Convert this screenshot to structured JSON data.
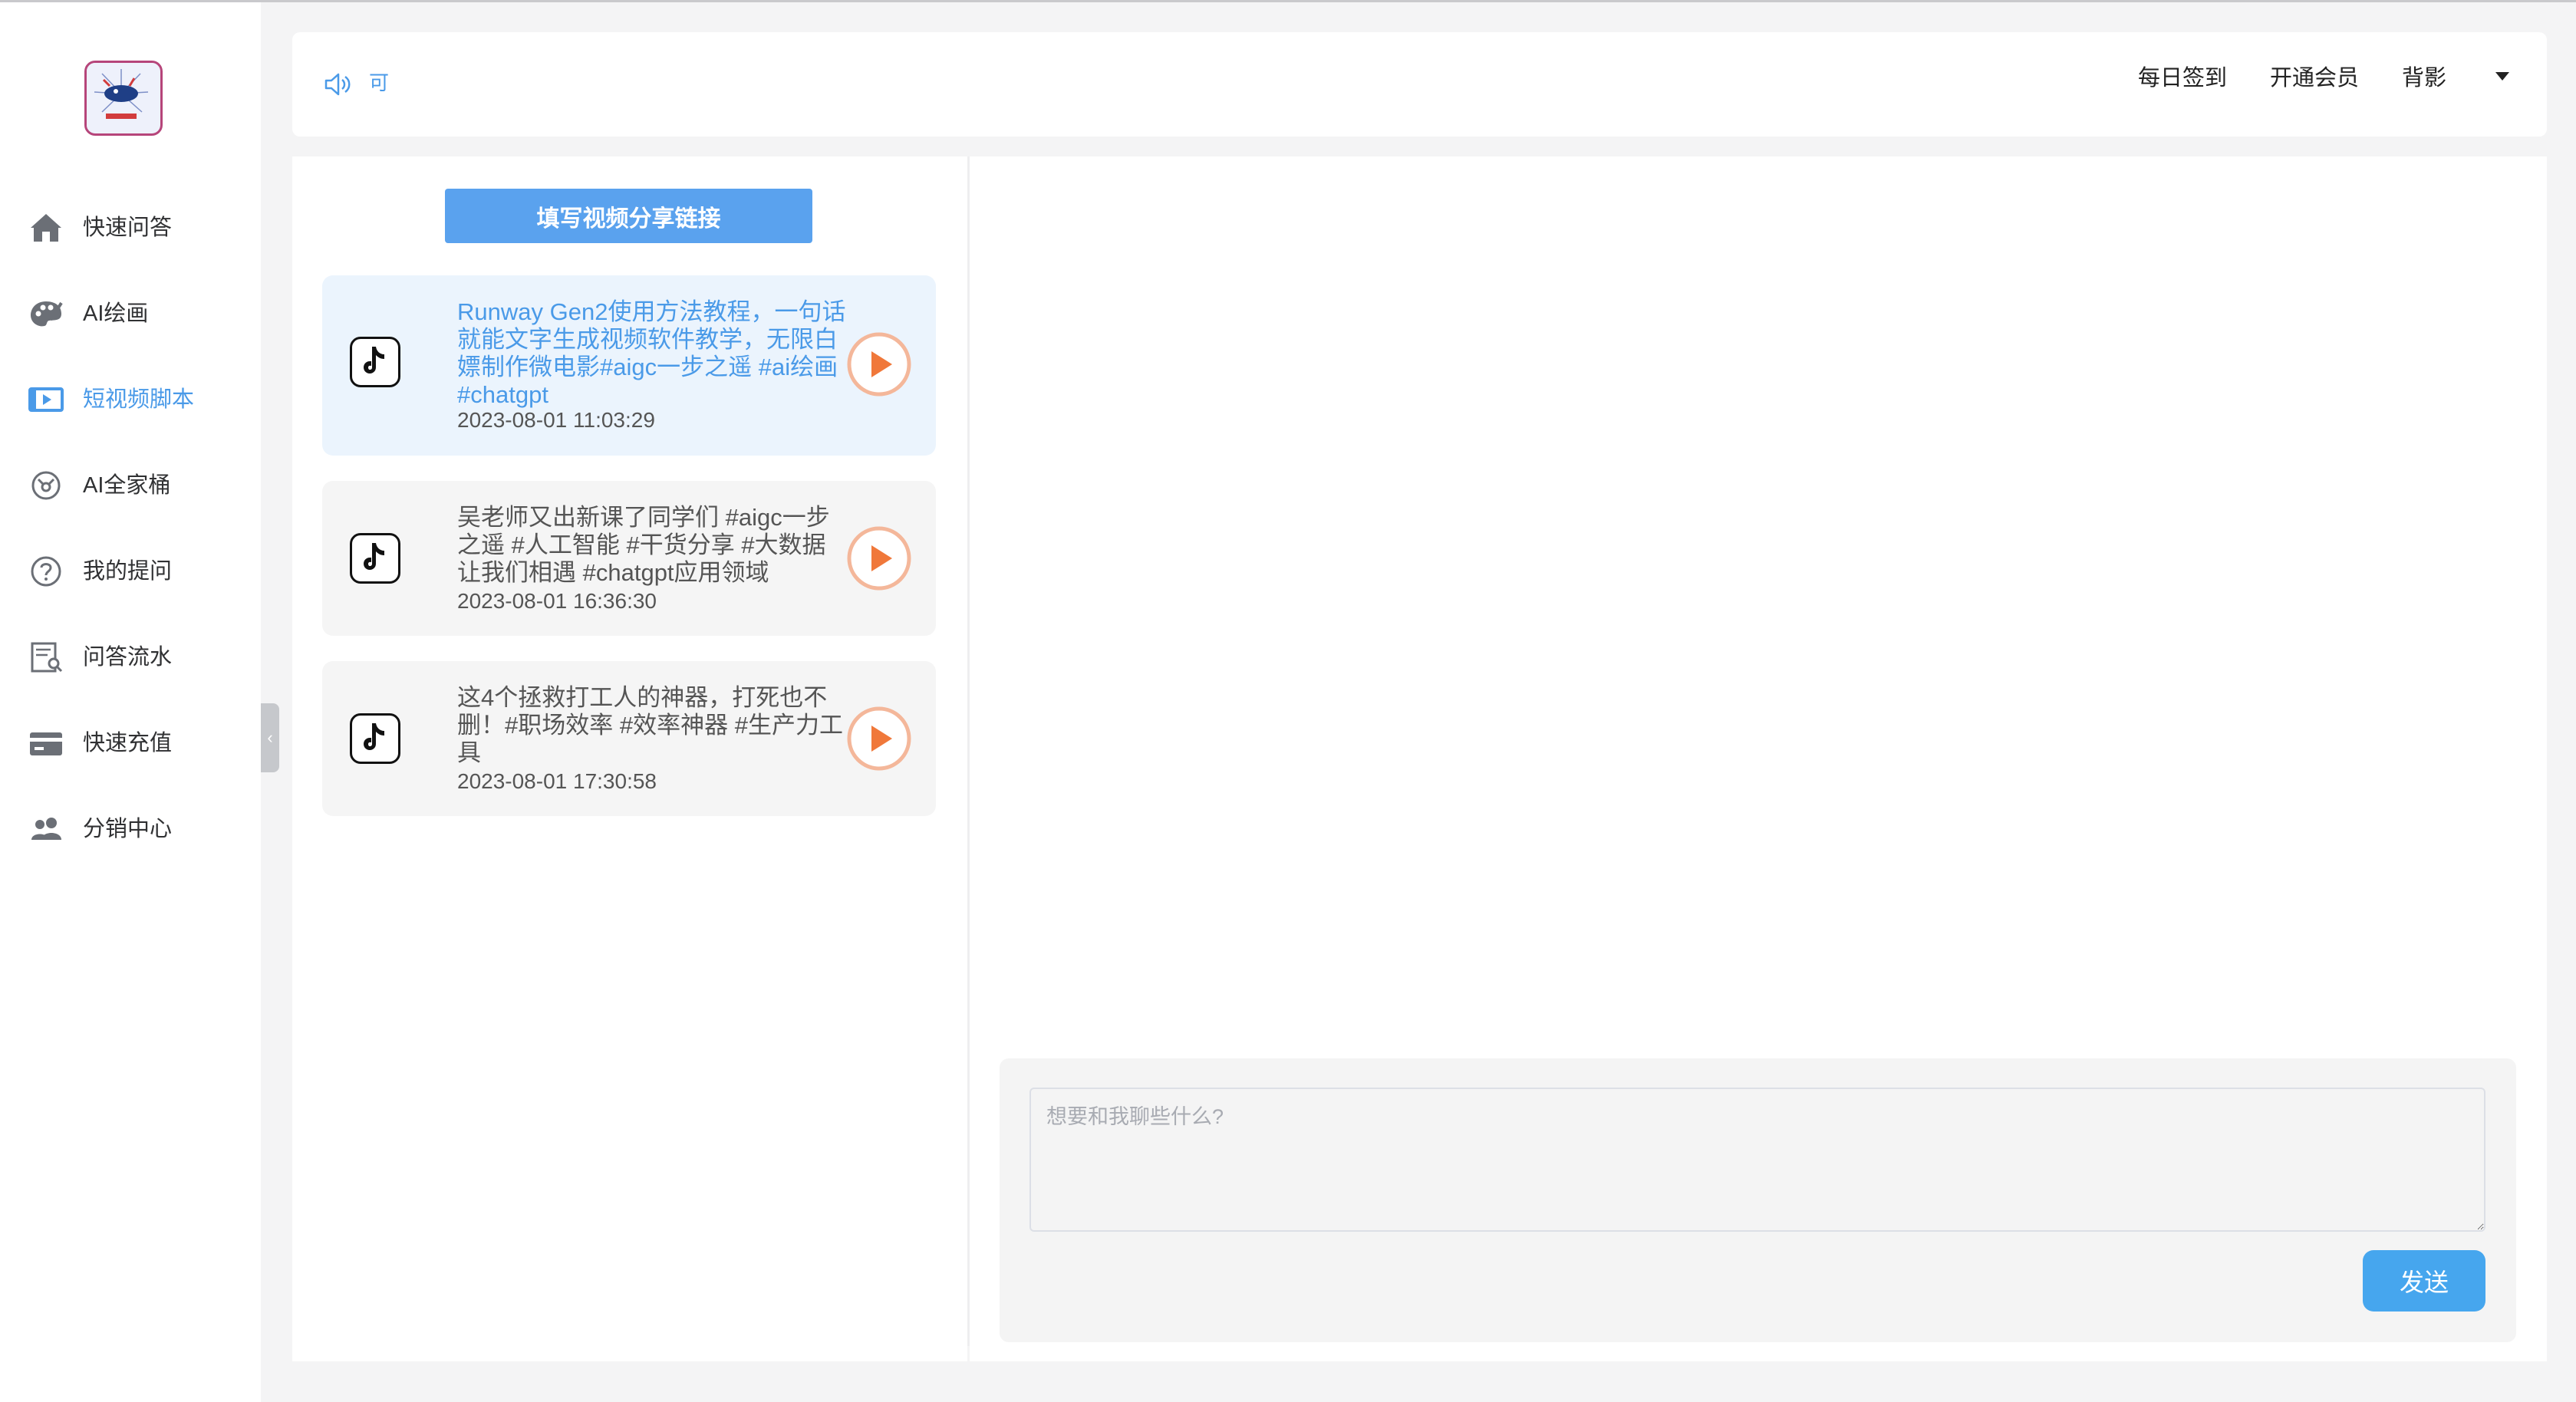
{
  "sidebar": {
    "items": [
      {
        "label": "快速问答",
        "icon": "home-icon"
      },
      {
        "label": "AI绘画",
        "icon": "palette-icon"
      },
      {
        "label": "短视频脚本",
        "icon": "video-icon"
      },
      {
        "label": "AI全家桶",
        "icon": "bucket-icon"
      },
      {
        "label": "我的提问",
        "icon": "question-icon"
      },
      {
        "label": "问答流水",
        "icon": "records-icon"
      },
      {
        "label": "快速充值",
        "icon": "card-icon"
      },
      {
        "label": "分销中心",
        "icon": "users-icon"
      }
    ],
    "active_index": 2,
    "collapse_glyph": "‹"
  },
  "header": {
    "marquee": "可",
    "links": [
      "每日签到",
      "开通会员",
      "背影"
    ]
  },
  "left": {
    "share_button": "填写视频分享链接",
    "videos": [
      {
        "title": "Runway Gen2使用方法教程，一句话就能文字生成视频软件教学，无限白嫖制作微电影#aigc一步之遥 #ai绘画 #chatgpt",
        "time": "2023-08-01 11:03:29"
      },
      {
        "title": "吴老师又出新课了同学们 #aigc一步之遥 #人工智能 #干货分享 #大数据让我们相遇 #chatgpt应用领域",
        "time": "2023-08-01 16:36:30"
      },
      {
        "title": "这4个拯救打工人的神器，打死也不删！#职场效率 #效率神器 #生产力工具",
        "time": "2023-08-01 17:30:58"
      }
    ]
  },
  "chat": {
    "placeholder": "想要和我聊些什么?",
    "send_label": "发送"
  },
  "colors": {
    "accent": "#4a9ae8",
    "share_button": "#5aa2ee",
    "send_button": "#46a6ee",
    "play": "#f0783a"
  }
}
